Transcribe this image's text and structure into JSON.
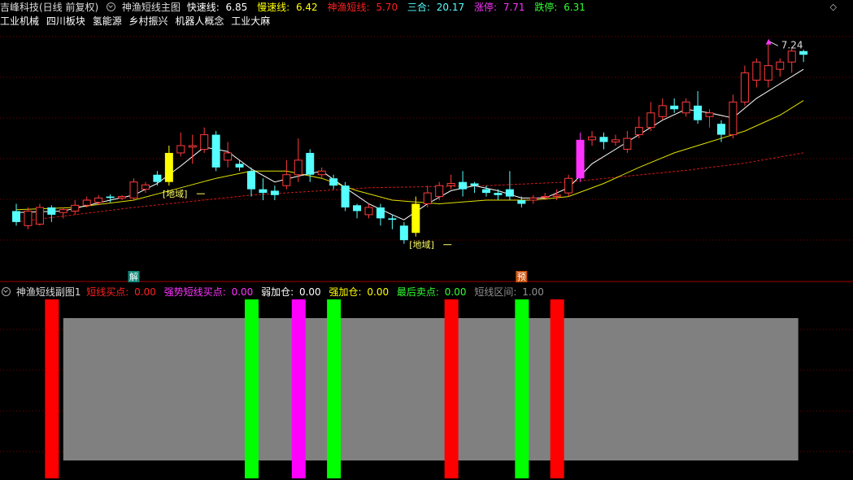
{
  "header": {
    "stock": "吉峰科技(日线 前复权)",
    "indicator": "神渔短线主图",
    "items": [
      {
        "label": "快速线: ",
        "value": "6.85",
        "color": "#ffffff"
      },
      {
        "label": "慢速线: ",
        "value": "6.42",
        "color": "#ffff00"
      },
      {
        "label": "神渔短线: ",
        "value": "5.70",
        "color": "#ff2020"
      },
      {
        "label": "三合: ",
        "value": "20.17",
        "color": "#55ffff"
      },
      {
        "label": "涨停: ",
        "value": "7.71",
        "color": "#ff33ff"
      },
      {
        "label": "跌停: ",
        "value": "6.31",
        "color": "#33ff33"
      }
    ]
  },
  "sectors": [
    "工业机械",
    "四川板块",
    "氢能源",
    "乡村振兴",
    "机器人概念",
    "工业大麻"
  ],
  "sub_header": {
    "title": "神渔短线副图1",
    "items": [
      {
        "label": "短线买点: ",
        "value": "0.00",
        "color": "#ff2020"
      },
      {
        "label": "强势短线买点: ",
        "value": "0.00",
        "color": "#ff33ff"
      },
      {
        "label": "弱加仓: ",
        "value": "0.00",
        "color": "#ffffff"
      },
      {
        "label": "强加仓: ",
        "value": "0.00",
        "color": "#ffff00"
      },
      {
        "label": "最后卖点: ",
        "value": "0.00",
        "color": "#33ff33"
      },
      {
        "label": "短线区间: ",
        "value": "1.00",
        "color": "#909090"
      }
    ]
  },
  "chart_data": {
    "type": "candlestick",
    "y_range": [
      4.2,
      7.4
    ],
    "up_color": "#ff3b3b",
    "down_color": "#55ffff",
    "candles": [
      [
        0,
        4.9,
        4.75,
        5.0,
        4.7
      ],
      [
        1,
        4.7,
        4.9,
        4.95,
        4.65
      ],
      [
        2,
        4.72,
        4.95,
        5.0,
        4.7
      ],
      [
        3,
        4.95,
        4.85,
        4.98,
        4.75
      ],
      [
        4,
        4.88,
        4.92,
        4.95,
        4.8
      ],
      [
        5,
        4.9,
        4.98,
        5.05,
        4.85
      ],
      [
        6,
        4.98,
        5.05,
        5.1,
        4.95
      ],
      [
        7,
        5.02,
        5.08,
        5.12,
        4.98
      ],
      [
        8,
        5.1,
        5.08,
        5.13,
        5.02
      ],
      [
        9,
        5.08,
        5.1,
        5.12,
        5.05
      ],
      [
        10,
        5.08,
        5.3,
        5.35,
        5.05
      ],
      [
        11,
        5.2,
        5.26,
        5.3,
        5.15
      ],
      [
        12,
        5.4,
        5.3,
        5.45,
        5.25
      ],
      [
        13,
        5.3,
        5.7,
        5.8,
        5.25
      ],
      [
        14,
        5.7,
        5.8,
        5.98,
        5.65
      ],
      [
        15,
        5.78,
        5.8,
        5.95,
        5.55
      ],
      [
        16,
        5.75,
        5.95,
        6.05,
        5.7
      ],
      [
        17,
        5.95,
        5.5,
        6.0,
        5.45
      ],
      [
        18,
        5.6,
        5.7,
        5.85,
        5.5
      ],
      [
        19,
        5.55,
        5.5,
        5.6,
        5.45
      ],
      [
        20,
        5.45,
        5.2,
        5.5,
        5.1
      ],
      [
        21,
        5.2,
        5.15,
        5.35,
        5.05
      ],
      [
        22,
        5.18,
        5.12,
        5.25,
        5.05
      ],
      [
        23,
        5.25,
        5.4,
        5.6,
        5.2
      ],
      [
        24,
        5.4,
        5.6,
        5.9,
        5.3
      ],
      [
        25,
        5.7,
        5.4,
        5.75,
        5.3
      ],
      [
        26,
        5.4,
        5.45,
        5.5,
        5.35
      ],
      [
        27,
        5.35,
        5.25,
        5.4,
        5.2
      ],
      [
        28,
        5.25,
        4.95,
        5.3,
        4.9
      ],
      [
        29,
        4.98,
        4.9,
        5.0,
        4.8
      ],
      [
        30,
        4.85,
        4.95,
        5.0,
        4.8
      ],
      [
        31,
        4.95,
        4.8,
        5.0,
        4.7
      ],
      [
        32,
        4.8,
        4.78,
        4.85,
        4.65
      ],
      [
        33,
        4.7,
        4.5,
        4.75,
        4.45
      ],
      [
        34,
        4.6,
        5.0,
        5.1,
        4.55
      ],
      [
        35,
        5.0,
        5.15,
        5.25,
        4.95
      ],
      [
        36,
        5.1,
        5.25,
        5.3,
        5.05
      ],
      [
        37,
        5.25,
        5.28,
        5.4,
        5.2
      ],
      [
        38,
        5.3,
        5.2,
        5.45,
        5.1
      ],
      [
        39,
        5.28,
        5.25,
        5.3,
        5.15
      ],
      [
        40,
        5.2,
        5.15,
        5.25,
        5.1
      ],
      [
        41,
        5.15,
        5.12,
        5.2,
        5.05
      ],
      [
        42,
        5.2,
        5.1,
        5.45,
        5.05
      ],
      [
        43,
        5.05,
        5.0,
        5.1,
        4.95
      ],
      [
        44,
        5.05,
        5.08,
        5.12,
        5.0
      ],
      [
        45,
        5.1,
        5.1,
        5.15,
        5.05
      ],
      [
        46,
        5.1,
        5.12,
        5.2,
        5.05
      ],
      [
        47,
        5.15,
        5.35,
        5.4,
        5.1
      ],
      [
        48,
        5.35,
        5.88,
        5.98,
        5.3
      ],
      [
        49,
        5.88,
        5.92,
        6.0,
        5.8
      ],
      [
        50,
        5.92,
        5.85,
        5.98,
        5.75
      ],
      [
        51,
        5.85,
        5.88,
        5.95,
        5.8
      ],
      [
        52,
        5.75,
        5.9,
        6.0,
        5.7
      ],
      [
        53,
        5.95,
        6.05,
        6.2,
        5.9
      ],
      [
        54,
        6.05,
        6.25,
        6.4,
        6.0
      ],
      [
        55,
        6.2,
        6.35,
        6.45,
        6.15
      ],
      [
        56,
        6.35,
        6.3,
        6.45,
        6.25
      ],
      [
        57,
        6.25,
        6.4,
        6.45,
        6.2
      ],
      [
        58,
        6.35,
        6.15,
        6.55,
        6.1
      ],
      [
        59,
        6.2,
        6.25,
        6.3,
        6.05
      ],
      [
        60,
        6.1,
        5.95,
        6.15,
        5.85
      ],
      [
        61,
        5.95,
        6.4,
        6.5,
        5.9
      ],
      [
        62,
        6.4,
        6.8,
        6.9,
        6.35
      ],
      [
        63,
        6.7,
        6.95,
        7.0,
        6.6
      ],
      [
        64,
        6.7,
        6.9,
        7.24,
        6.6
      ],
      [
        65,
        6.85,
        6.95,
        7.0,
        6.75
      ],
      [
        66,
        6.95,
        7.1,
        7.15,
        6.8
      ],
      [
        67,
        7.1,
        7.05,
        7.12,
        6.95
      ]
    ],
    "fast_line": [
      [
        0,
        4.88
      ],
      [
        4,
        4.9
      ],
      [
        8,
        5.05
      ],
      [
        10,
        5.12
      ],
      [
        12,
        5.28
      ],
      [
        14,
        5.52
      ],
      [
        16,
        5.78
      ],
      [
        18,
        5.72
      ],
      [
        20,
        5.48
      ],
      [
        22,
        5.3
      ],
      [
        24,
        5.38
      ],
      [
        26,
        5.45
      ],
      [
        28,
        5.22
      ],
      [
        30,
        5.0
      ],
      [
        32,
        4.85
      ],
      [
        33,
        4.78
      ],
      [
        35,
        5.0
      ],
      [
        37,
        5.18
      ],
      [
        39,
        5.25
      ],
      [
        41,
        5.18
      ],
      [
        43,
        5.08
      ],
      [
        45,
        5.08
      ],
      [
        47,
        5.22
      ],
      [
        49,
        5.55
      ],
      [
        51,
        5.75
      ],
      [
        53,
        5.95
      ],
      [
        55,
        6.15
      ],
      [
        57,
        6.3
      ],
      [
        59,
        6.25
      ],
      [
        61,
        6.18
      ],
      [
        63,
        6.45
      ],
      [
        65,
        6.65
      ],
      [
        67,
        6.85
      ]
    ],
    "slow_line": [
      [
        0,
        4.92
      ],
      [
        5,
        4.95
      ],
      [
        10,
        5.05
      ],
      [
        14,
        5.22
      ],
      [
        17,
        5.35
      ],
      [
        20,
        5.45
      ],
      [
        23,
        5.45
      ],
      [
        26,
        5.35
      ],
      [
        29,
        5.18
      ],
      [
        32,
        5.05
      ],
      [
        36,
        5.0
      ],
      [
        40,
        5.05
      ],
      [
        44,
        5.05
      ],
      [
        47,
        5.1
      ],
      [
        50,
        5.28
      ],
      [
        53,
        5.5
      ],
      [
        56,
        5.7
      ],
      [
        59,
        5.85
      ],
      [
        62,
        6.0
      ],
      [
        65,
        6.22
      ],
      [
        67,
        6.42
      ]
    ],
    "signal_line": [
      [
        0,
        4.75
      ],
      [
        10,
        4.95
      ],
      [
        20,
        5.12
      ],
      [
        30,
        5.22
      ],
      [
        40,
        5.25
      ],
      [
        47,
        5.3
      ],
      [
        52,
        5.38
      ],
      [
        57,
        5.46
      ],
      [
        62,
        5.56
      ],
      [
        67,
        5.7
      ]
    ],
    "special_candles": [
      {
        "i": 13,
        "color": "#ffff00"
      },
      {
        "i": 34,
        "color": "#ffff00"
      },
      {
        "i": 48,
        "color": "#ff33ff"
      }
    ],
    "peak_label": "7.24",
    "annotations": [
      {
        "i": 13,
        "text": "[地域]"
      },
      {
        "i": 34,
        "text": "[地域]"
      }
    ],
    "markers": [
      {
        "i": 10,
        "text": "解",
        "bg": "#11887a"
      },
      {
        "i": 43,
        "text": "预",
        "bg": "#cc5511"
      }
    ],
    "sub_range_bar": {
      "from_i": 4,
      "to_i": 66,
      "color": "#808080"
    },
    "sub_bars": [
      {
        "i": 3,
        "color": "#ff0000"
      },
      {
        "i": 20,
        "color": "#00ff00"
      },
      {
        "i": 24,
        "color": "#ff00ff"
      },
      {
        "i": 27,
        "color": "#00ff00"
      },
      {
        "i": 37,
        "color": "#ff0000"
      },
      {
        "i": 43,
        "color": "#00ff00"
      },
      {
        "i": 46,
        "color": "#ff0000"
      }
    ]
  }
}
